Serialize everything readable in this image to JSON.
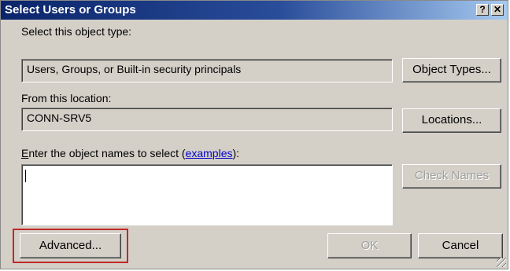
{
  "window": {
    "title": "Select Users or Groups",
    "help_glyph": "?",
    "close_glyph": "✕"
  },
  "object_type": {
    "label": "Select this object type:",
    "value": "Users, Groups, or Built-in security principals",
    "button": "Object Types..."
  },
  "location": {
    "label": "From this location:",
    "value": "CONN-SRV5",
    "button": "Locations..."
  },
  "names": {
    "label_mnemonic": "E",
    "label_rest": "nter the object names to select (",
    "link": "examples",
    "label_end": "):",
    "value": "",
    "check_button": "Check Names"
  },
  "footer": {
    "advanced": "Advanced...",
    "ok": "OK",
    "cancel": "Cancel"
  },
  "colors": {
    "highlight": "#c0282a",
    "title_bar": "#0a246a",
    "face": "#d4d0c8"
  }
}
